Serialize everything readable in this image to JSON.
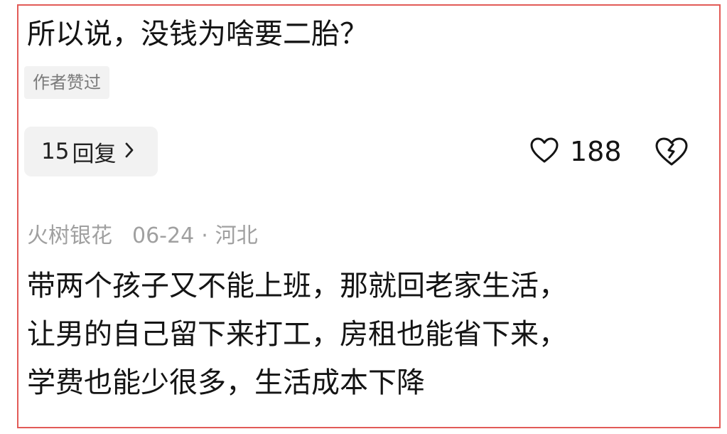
{
  "comment": {
    "text": "所以说，没钱为啥要二胎？",
    "author_liked_badge": "作者赞过",
    "replies_count": "15",
    "replies_label": "回复",
    "like_count": "188"
  },
  "reply": {
    "username": "火树银花",
    "date": "06-24",
    "separator": "·",
    "location": "河北",
    "lines": [
      "带两个孩子又不能上班，那就回老家生活，",
      "让男的自己留下来打工，房租也能省下来，",
      "学费也能少很多，生活成本下降"
    ]
  },
  "colors": {
    "frame": "#e25b57",
    "text": "#141414",
    "muted": "#a0a0a0",
    "chip_bg": "#f2f2f2"
  }
}
